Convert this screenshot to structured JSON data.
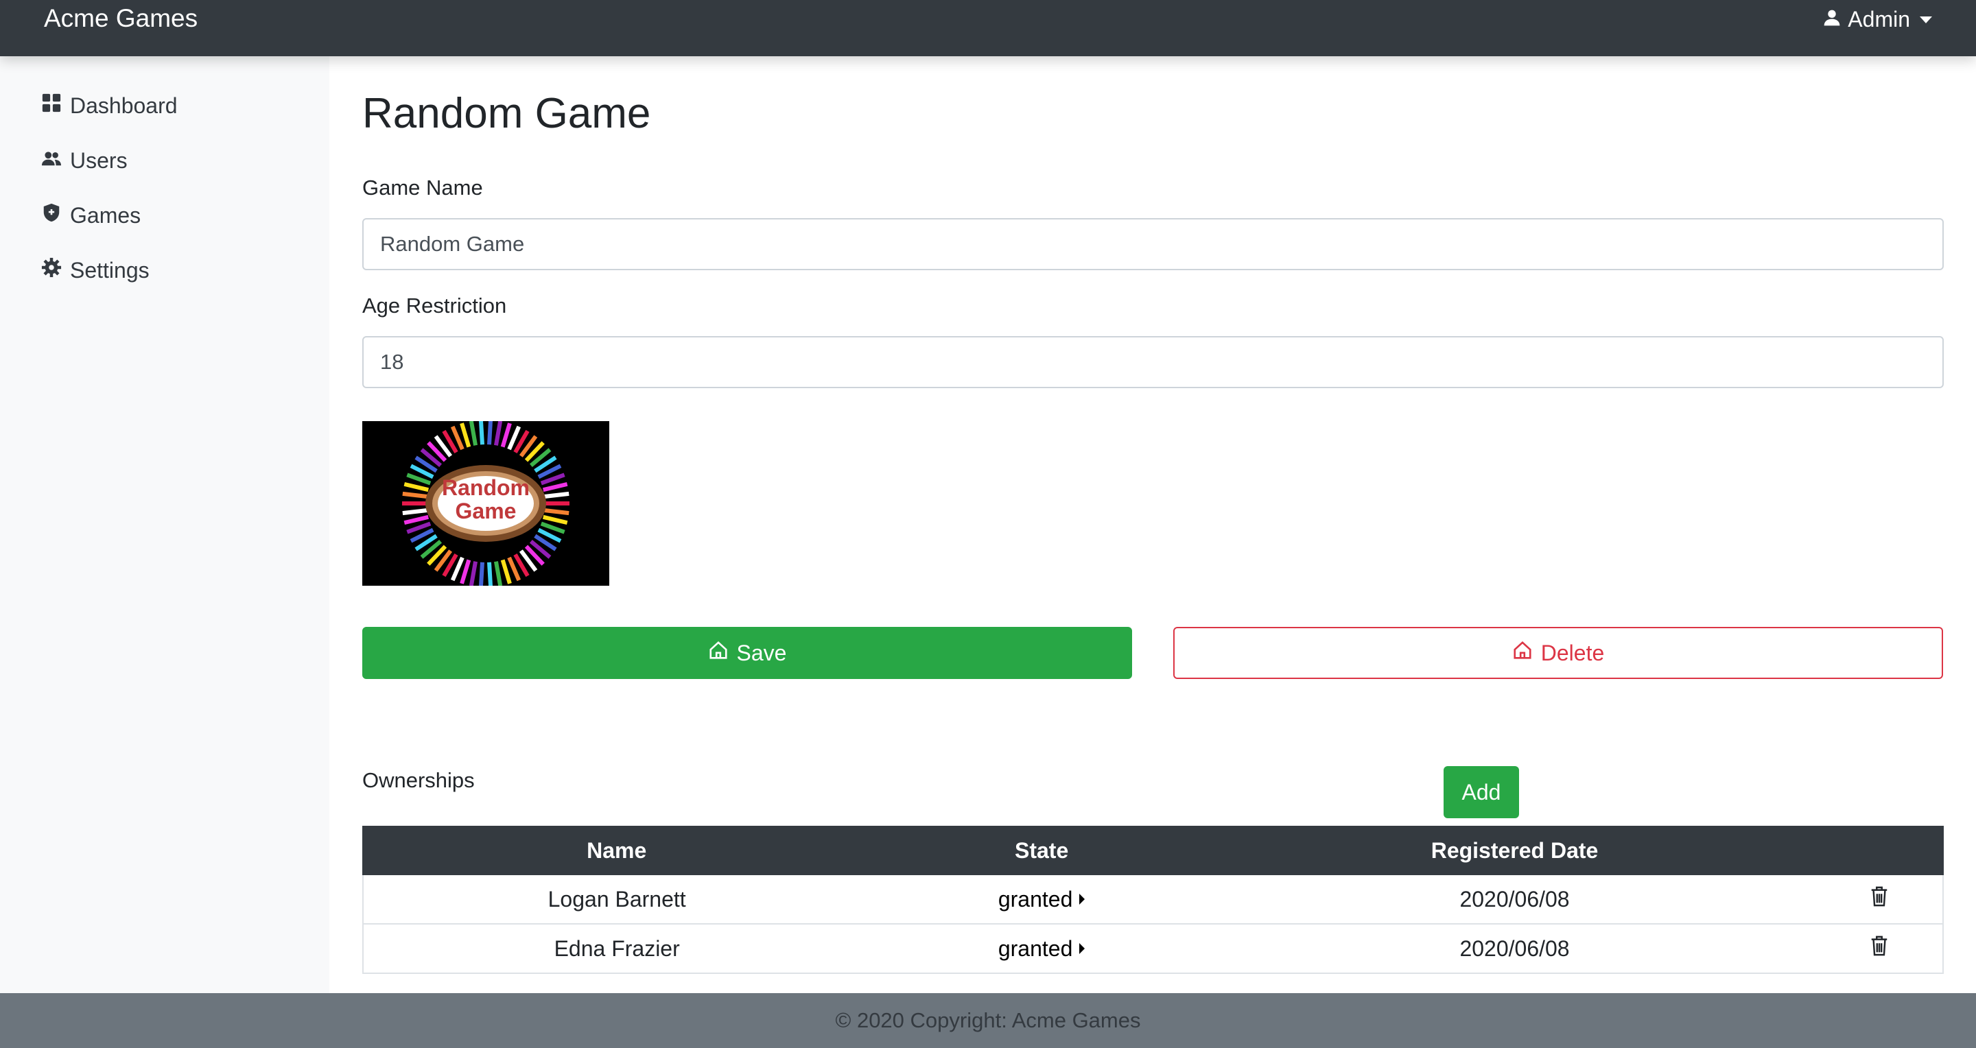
{
  "navbar": {
    "brand": "Acme Games",
    "user_label": "Admin",
    "user_icon": "person-icon"
  },
  "sidebar": {
    "items": [
      {
        "label": "Dashboard",
        "icon": "grid-icon"
      },
      {
        "label": "Users",
        "icon": "people-icon"
      },
      {
        "label": "Games",
        "icon": "shield-icon"
      },
      {
        "label": "Settings",
        "icon": "gear-icon"
      }
    ]
  },
  "main": {
    "title": "Random Game",
    "fields": {
      "game_name_label": "Game Name",
      "game_name_value": "Random Game",
      "age_label": "Age Restriction",
      "age_value": "18"
    },
    "image": {
      "text_line1": "Random",
      "text_line2": "Game"
    },
    "save_label": "Save",
    "delete_label": "Delete",
    "ownerships": {
      "label": "Ownerships",
      "add_label": "Add",
      "columns": [
        "Name",
        "State",
        "Registered Date"
      ],
      "rows": [
        {
          "name": "Logan Barnett",
          "state": "granted",
          "date": "2020/06/08"
        },
        {
          "name": "Edna Frazier",
          "state": "granted",
          "date": "2020/06/08"
        }
      ]
    }
  },
  "footer": {
    "text": "© 2020 Copyright: Acme Games"
  },
  "colors": {
    "navbar": "#343a40",
    "sidebar": "#f8f9fa",
    "success": "#28a745",
    "danger": "#dc3545",
    "footer": "#6c757d"
  }
}
